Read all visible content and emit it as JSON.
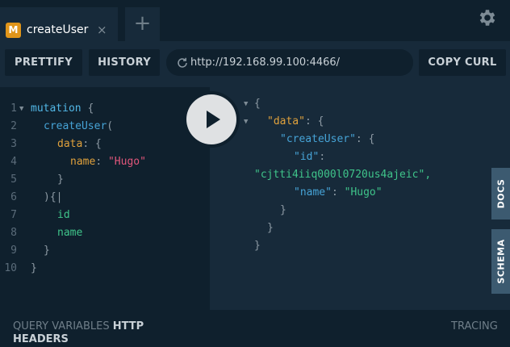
{
  "tab": {
    "badge": "M",
    "title": "createUser",
    "close": "×"
  },
  "new_tab": "+",
  "toolbar": {
    "prettify": "PRETTIFY",
    "history": "HISTORY",
    "copy_curl": "COPY CURL"
  },
  "url": "http://192.168.99.100:4466/",
  "editor_lines": [
    "1",
    "2",
    "3",
    "4",
    "5",
    "6",
    "7",
    "8",
    "9",
    "10"
  ],
  "query": {
    "mutation_kw": "mutation",
    "brace_open": "{",
    "create_user": "createUser",
    "paren_open": "(",
    "data_arg": "data",
    "colon": ":",
    "name_key": "name",
    "name_value": "\"Hugo\"",
    "brace_close": "}",
    "paren_close_brace": "){",
    "cursor": "|",
    "field_id": "id",
    "field_name": "name"
  },
  "result": {
    "open": "{",
    "data_key": "\"data\"",
    "create_user_key": "\"createUser\"",
    "id_key": "\"id\"",
    "id_value": "\"cjtti4iiq000l0720us4ajeic\",",
    "name_key": "\"name\"",
    "name_value": "\"Hugo\"",
    "colon_brace": ": {",
    "colon": ":",
    "close": "}"
  },
  "side_tabs": {
    "docs": "DOCS",
    "schema": "SCHEMA"
  },
  "bottom": {
    "query_variables": "QUERY VARIABLES",
    "http": "HTTP",
    "headers": "HEADERS",
    "tracing": "TRACING"
  },
  "icons": {
    "settings": "gear-icon",
    "reload": "reload-icon",
    "play": "play-icon"
  },
  "colors": {
    "accent": "#e0951a",
    "background": "#172a3a",
    "panel": "#0f202d"
  }
}
